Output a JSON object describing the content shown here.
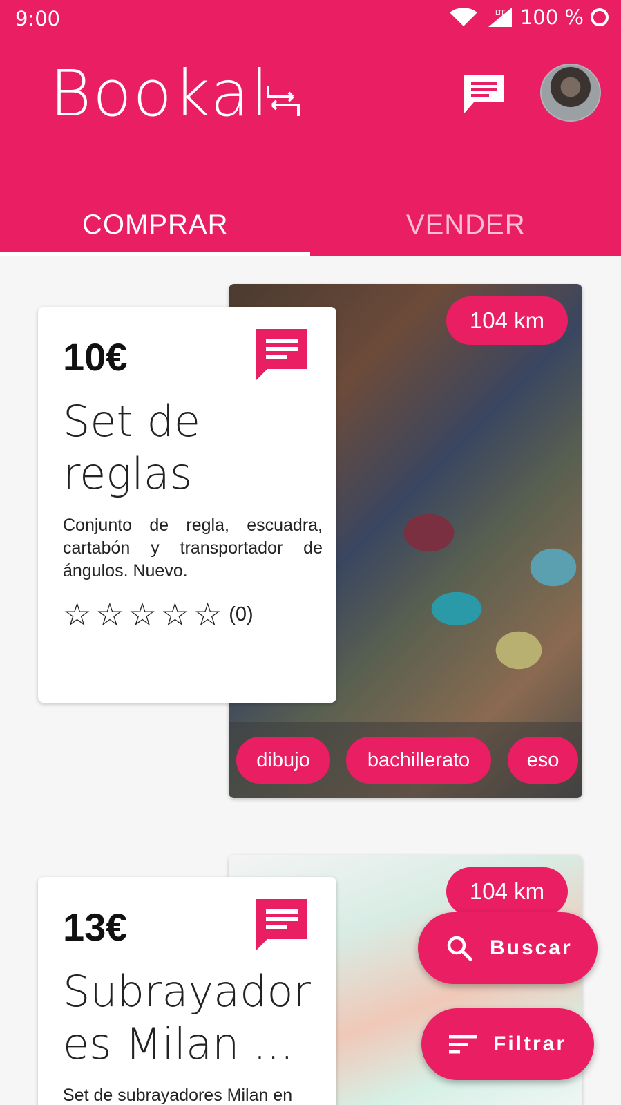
{
  "status_bar": {
    "time": "9:00",
    "battery": "100 %"
  },
  "app": {
    "logo_text": "Bookal"
  },
  "tabs": [
    {
      "label": "COMPRAR",
      "active": true
    },
    {
      "label": "VENDER",
      "active": false
    }
  ],
  "products": [
    {
      "price": "10€",
      "title": "Set de reglas",
      "description": "Conjunto de regla, escuadra, cartabón y transportador de ángulos. Nuevo.",
      "rating": 0,
      "rating_count": "(0)",
      "distance": "104 km",
      "tags": [
        "dibujo",
        "bachillerato",
        "eso"
      ]
    },
    {
      "price": "13€",
      "title": "Subrayador es Milan ...",
      "description": "Set de subrayadores Milan en",
      "distance": "104 km"
    }
  ],
  "actions": {
    "search_label": "Buscar",
    "filter_label": "Filtrar"
  },
  "colors": {
    "primary": "#e91e63",
    "background": "#f6f6f6",
    "card": "#ffffff"
  },
  "icons": [
    "wifi-icon",
    "signal-icon",
    "circle-icon",
    "swap-icon",
    "message-icon",
    "search-icon",
    "filter-icon",
    "star-outline-icon"
  ]
}
